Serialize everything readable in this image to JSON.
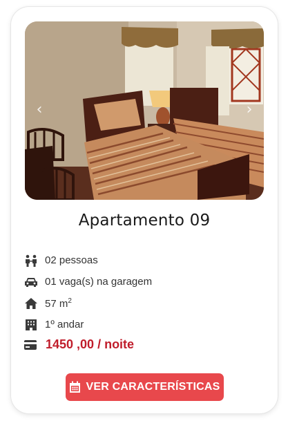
{
  "card": {
    "title": "Apartamento 09",
    "photo": {
      "prev_icon": "chevron-left-icon",
      "next_icon": "chevron-right-icon",
      "prev_glyph": "‹",
      "next_glyph": "›"
    },
    "features": [
      {
        "icon": "people-icon",
        "text": "02 pessoas"
      },
      {
        "icon": "car-icon",
        "text": "01 vaga(s) na garagem"
      },
      {
        "icon": "home-icon",
        "text": "57 m",
        "superscript": "2"
      },
      {
        "icon": "building-icon",
        "text": "1º andar"
      }
    ],
    "price": {
      "icon": "credit-card-icon",
      "text": "1450 ,00 / noite"
    },
    "cta": {
      "icon": "calendar-icon",
      "label": "VER CARACTERÍSTICAS"
    }
  },
  "colors": {
    "price": "#c01d2b",
    "button": "#e8484c",
    "text": "#333333"
  }
}
